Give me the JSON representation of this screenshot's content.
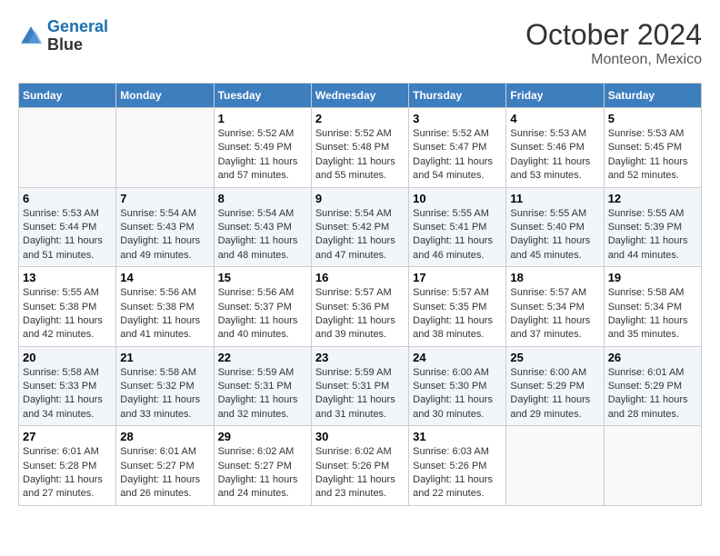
{
  "header": {
    "logo_line1": "General",
    "logo_line2": "Blue",
    "month_year": "October 2024",
    "location": "Monteon, Mexico"
  },
  "days_of_week": [
    "Sunday",
    "Monday",
    "Tuesday",
    "Wednesday",
    "Thursday",
    "Friday",
    "Saturday"
  ],
  "weeks": [
    [
      {
        "day": "",
        "sunrise": "",
        "sunset": "",
        "daylight": ""
      },
      {
        "day": "",
        "sunrise": "",
        "sunset": "",
        "daylight": ""
      },
      {
        "day": "1",
        "sunrise": "Sunrise: 5:52 AM",
        "sunset": "Sunset: 5:49 PM",
        "daylight": "Daylight: 11 hours and 57 minutes."
      },
      {
        "day": "2",
        "sunrise": "Sunrise: 5:52 AM",
        "sunset": "Sunset: 5:48 PM",
        "daylight": "Daylight: 11 hours and 55 minutes."
      },
      {
        "day": "3",
        "sunrise": "Sunrise: 5:52 AM",
        "sunset": "Sunset: 5:47 PM",
        "daylight": "Daylight: 11 hours and 54 minutes."
      },
      {
        "day": "4",
        "sunrise": "Sunrise: 5:53 AM",
        "sunset": "Sunset: 5:46 PM",
        "daylight": "Daylight: 11 hours and 53 minutes."
      },
      {
        "day": "5",
        "sunrise": "Sunrise: 5:53 AM",
        "sunset": "Sunset: 5:45 PM",
        "daylight": "Daylight: 11 hours and 52 minutes."
      }
    ],
    [
      {
        "day": "6",
        "sunrise": "Sunrise: 5:53 AM",
        "sunset": "Sunset: 5:44 PM",
        "daylight": "Daylight: 11 hours and 51 minutes."
      },
      {
        "day": "7",
        "sunrise": "Sunrise: 5:54 AM",
        "sunset": "Sunset: 5:43 PM",
        "daylight": "Daylight: 11 hours and 49 minutes."
      },
      {
        "day": "8",
        "sunrise": "Sunrise: 5:54 AM",
        "sunset": "Sunset: 5:43 PM",
        "daylight": "Daylight: 11 hours and 48 minutes."
      },
      {
        "day": "9",
        "sunrise": "Sunrise: 5:54 AM",
        "sunset": "Sunset: 5:42 PM",
        "daylight": "Daylight: 11 hours and 47 minutes."
      },
      {
        "day": "10",
        "sunrise": "Sunrise: 5:55 AM",
        "sunset": "Sunset: 5:41 PM",
        "daylight": "Daylight: 11 hours and 46 minutes."
      },
      {
        "day": "11",
        "sunrise": "Sunrise: 5:55 AM",
        "sunset": "Sunset: 5:40 PM",
        "daylight": "Daylight: 11 hours and 45 minutes."
      },
      {
        "day": "12",
        "sunrise": "Sunrise: 5:55 AM",
        "sunset": "Sunset: 5:39 PM",
        "daylight": "Daylight: 11 hours and 44 minutes."
      }
    ],
    [
      {
        "day": "13",
        "sunrise": "Sunrise: 5:55 AM",
        "sunset": "Sunset: 5:38 PM",
        "daylight": "Daylight: 11 hours and 42 minutes."
      },
      {
        "day": "14",
        "sunrise": "Sunrise: 5:56 AM",
        "sunset": "Sunset: 5:38 PM",
        "daylight": "Daylight: 11 hours and 41 minutes."
      },
      {
        "day": "15",
        "sunrise": "Sunrise: 5:56 AM",
        "sunset": "Sunset: 5:37 PM",
        "daylight": "Daylight: 11 hours and 40 minutes."
      },
      {
        "day": "16",
        "sunrise": "Sunrise: 5:57 AM",
        "sunset": "Sunset: 5:36 PM",
        "daylight": "Daylight: 11 hours and 39 minutes."
      },
      {
        "day": "17",
        "sunrise": "Sunrise: 5:57 AM",
        "sunset": "Sunset: 5:35 PM",
        "daylight": "Daylight: 11 hours and 38 minutes."
      },
      {
        "day": "18",
        "sunrise": "Sunrise: 5:57 AM",
        "sunset": "Sunset: 5:34 PM",
        "daylight": "Daylight: 11 hours and 37 minutes."
      },
      {
        "day": "19",
        "sunrise": "Sunrise: 5:58 AM",
        "sunset": "Sunset: 5:34 PM",
        "daylight": "Daylight: 11 hours and 35 minutes."
      }
    ],
    [
      {
        "day": "20",
        "sunrise": "Sunrise: 5:58 AM",
        "sunset": "Sunset: 5:33 PM",
        "daylight": "Daylight: 11 hours and 34 minutes."
      },
      {
        "day": "21",
        "sunrise": "Sunrise: 5:58 AM",
        "sunset": "Sunset: 5:32 PM",
        "daylight": "Daylight: 11 hours and 33 minutes."
      },
      {
        "day": "22",
        "sunrise": "Sunrise: 5:59 AM",
        "sunset": "Sunset: 5:31 PM",
        "daylight": "Daylight: 11 hours and 32 minutes."
      },
      {
        "day": "23",
        "sunrise": "Sunrise: 5:59 AM",
        "sunset": "Sunset: 5:31 PM",
        "daylight": "Daylight: 11 hours and 31 minutes."
      },
      {
        "day": "24",
        "sunrise": "Sunrise: 6:00 AM",
        "sunset": "Sunset: 5:30 PM",
        "daylight": "Daylight: 11 hours and 30 minutes."
      },
      {
        "day": "25",
        "sunrise": "Sunrise: 6:00 AM",
        "sunset": "Sunset: 5:29 PM",
        "daylight": "Daylight: 11 hours and 29 minutes."
      },
      {
        "day": "26",
        "sunrise": "Sunrise: 6:01 AM",
        "sunset": "Sunset: 5:29 PM",
        "daylight": "Daylight: 11 hours and 28 minutes."
      }
    ],
    [
      {
        "day": "27",
        "sunrise": "Sunrise: 6:01 AM",
        "sunset": "Sunset: 5:28 PM",
        "daylight": "Daylight: 11 hours and 27 minutes."
      },
      {
        "day": "28",
        "sunrise": "Sunrise: 6:01 AM",
        "sunset": "Sunset: 5:27 PM",
        "daylight": "Daylight: 11 hours and 26 minutes."
      },
      {
        "day": "29",
        "sunrise": "Sunrise: 6:02 AM",
        "sunset": "Sunset: 5:27 PM",
        "daylight": "Daylight: 11 hours and 24 minutes."
      },
      {
        "day": "30",
        "sunrise": "Sunrise: 6:02 AM",
        "sunset": "Sunset: 5:26 PM",
        "daylight": "Daylight: 11 hours and 23 minutes."
      },
      {
        "day": "31",
        "sunrise": "Sunrise: 6:03 AM",
        "sunset": "Sunset: 5:26 PM",
        "daylight": "Daylight: 11 hours and 22 minutes."
      },
      {
        "day": "",
        "sunrise": "",
        "sunset": "",
        "daylight": ""
      },
      {
        "day": "",
        "sunrise": "",
        "sunset": "",
        "daylight": ""
      }
    ]
  ]
}
